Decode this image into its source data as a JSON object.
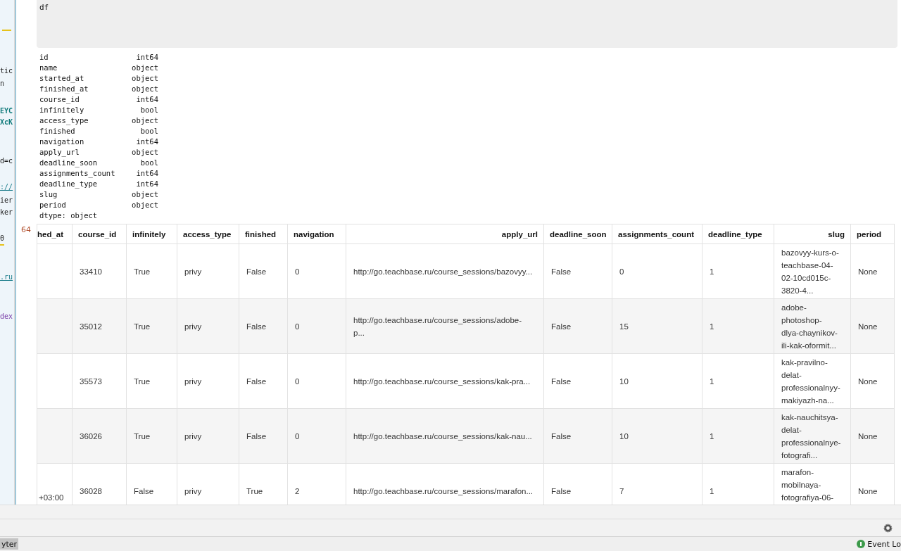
{
  "editor_fragments": [
    {
      "text": "tic",
      "kind": "plain"
    },
    {
      "text": "n",
      "kind": "plain"
    },
    {
      "text": "EYC",
      "kind": "string"
    },
    {
      "text": "XcK",
      "kind": "string"
    },
    {
      "text": "d=c",
      "kind": "plain"
    },
    {
      "text": "://",
      "kind": "link"
    },
    {
      "text": "ier",
      "kind": "plain"
    },
    {
      "text": "ker",
      "kind": "plain"
    },
    {
      "text": "0",
      "kind": "marked"
    },
    {
      "text": ".ru",
      "kind": "link"
    },
    {
      "text": "dex",
      "kind": "keyword"
    }
  ],
  "code_cell": {
    "source": "df"
  },
  "dtypes": [
    {
      "name": "id",
      "type": "int64"
    },
    {
      "name": "name",
      "type": "object"
    },
    {
      "name": "started_at",
      "type": "object"
    },
    {
      "name": "finished_at",
      "type": "object"
    },
    {
      "name": "course_id",
      "type": "int64"
    },
    {
      "name": "infinitely",
      "type": "bool"
    },
    {
      "name": "access_type",
      "type": "object"
    },
    {
      "name": "finished",
      "type": "bool"
    },
    {
      "name": "navigation",
      "type": "int64"
    },
    {
      "name": "apply_url",
      "type": "object"
    },
    {
      "name": "deadline_soon",
      "type": "bool"
    },
    {
      "name": "assignments_count",
      "type": "int64"
    },
    {
      "name": "deadline_type",
      "type": "int64"
    },
    {
      "name": "slug",
      "type": "object"
    },
    {
      "name": "period",
      "type": "object"
    }
  ],
  "dtype_footer": "dtype: object",
  "execution_count": "64",
  "table": {
    "columns": [
      "hed_at",
      "course_id",
      "infinitely",
      "access_type",
      "finished",
      "navigation",
      "apply_url",
      "deadline_soon",
      "assignments_count",
      "deadline_type",
      "slug",
      "period"
    ],
    "rows": [
      {
        "cells": [
          "",
          "33410",
          "True",
          "privy",
          "False",
          "0",
          "http://go.teachbase.ru/course_sessions/bazovyy...",
          "False",
          "0",
          "1",
          "bazovyy-kurs-o-\nteachbase-04-\n02-10cd015c-\n3820-4...",
          "None"
        ]
      },
      {
        "cells": [
          "",
          "35012",
          "True",
          "privy",
          "False",
          "0",
          "http://go.teachbase.ru/course_sessions/adobe-\np...",
          "False",
          "15",
          "1",
          "adobe-\nphotoshop-\ndlya-chaynikov-\nili-kak-oformit...",
          "None"
        ]
      },
      {
        "cells": [
          "",
          "35573",
          "True",
          "privy",
          "False",
          "0",
          "http://go.teachbase.ru/course_sessions/kak-pra...",
          "False",
          "10",
          "1",
          "kak-pravilno-\ndelat-\nprofessionalnyy-\nmakiyazh-na...",
          "None"
        ]
      },
      {
        "cells": [
          "",
          "36026",
          "True",
          "privy",
          "False",
          "0",
          "http://go.teachbase.ru/course_sessions/kak-nau...",
          "False",
          "10",
          "1",
          "kak-nauchitsya-\ndelat-\nprofessionalnye-\nfotografi...",
          "None"
        ]
      },
      {
        "truncated": true,
        "cells": [
          "+03:00",
          "36028",
          "False",
          "privy",
          "True",
          "2",
          "http://go.teachbase.ru/course_sessions/marafon...",
          "False",
          "7",
          "1",
          "marafon-\nmobilnaya-\nfotografiya-06-",
          "None"
        ]
      }
    ]
  },
  "status_bar": {
    "left_tab": "yter",
    "event_log": "Event Lo"
  }
}
